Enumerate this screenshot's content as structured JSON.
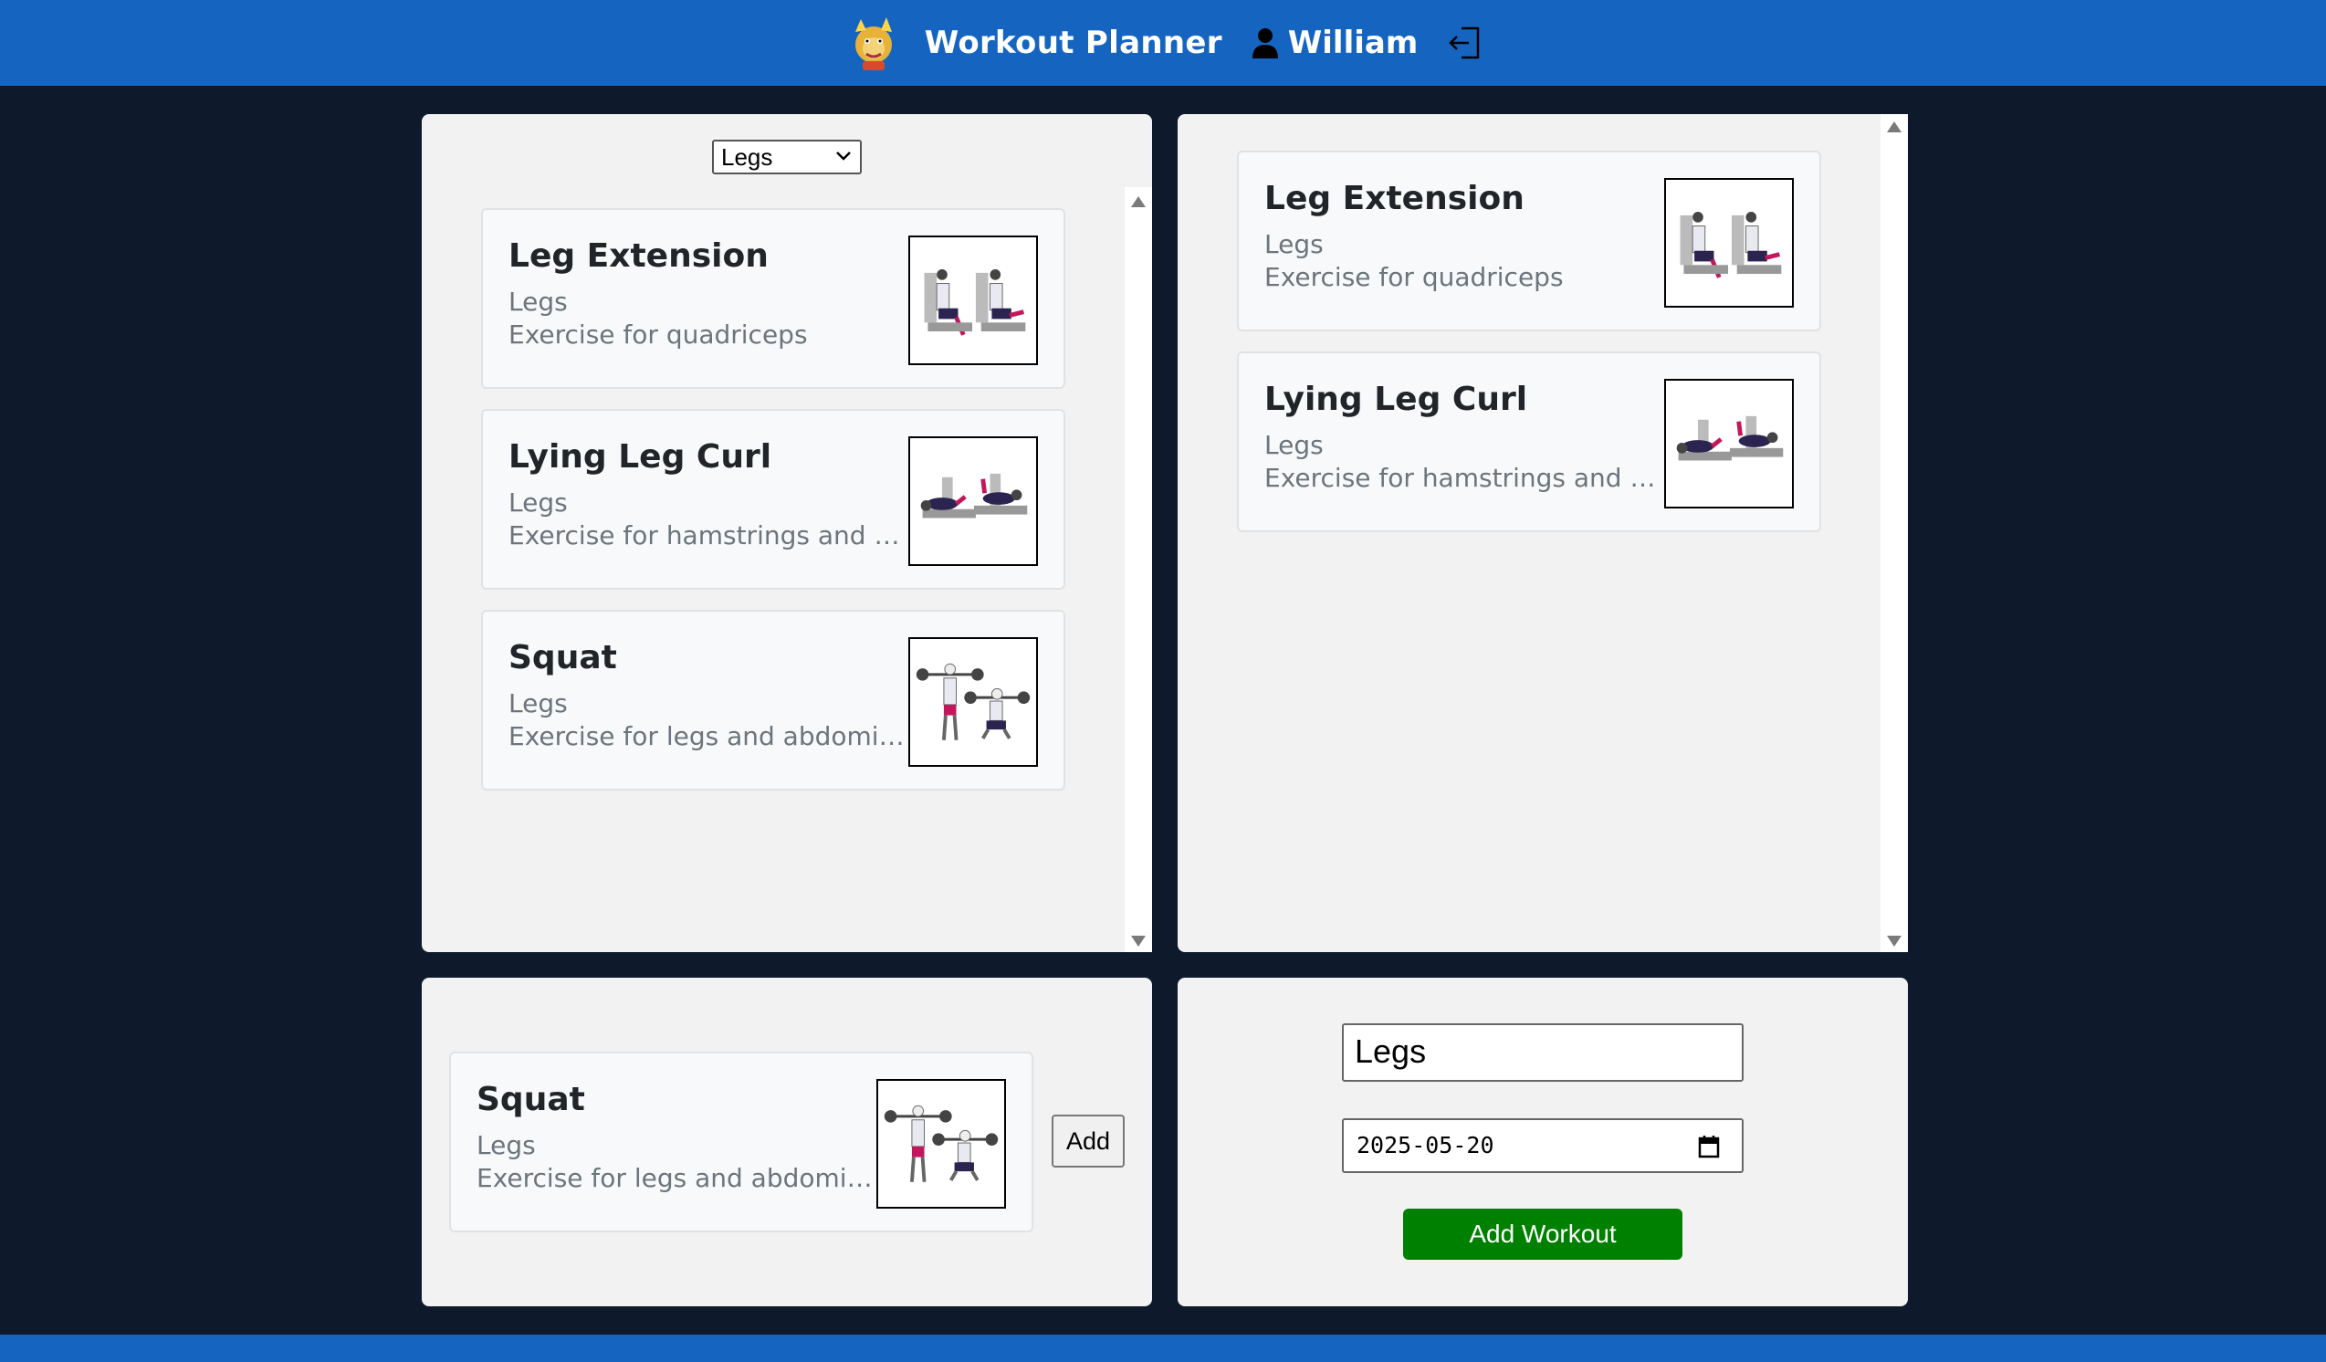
{
  "header": {
    "title": "Workout Planner",
    "username": "William"
  },
  "exercise_list": {
    "category_filter": "Legs",
    "exercises": [
      {
        "name": "Leg Extension",
        "category": "Legs",
        "description": "Exercise for quadriceps"
      },
      {
        "name": "Lying Leg Curl",
        "category": "Legs",
        "description": "Exercise for hamstrings and c..."
      },
      {
        "name": "Squat",
        "category": "Legs",
        "description": "Exercise for legs and abdomin..."
      }
    ]
  },
  "workout_plan": {
    "exercises": [
      {
        "name": "Leg Extension",
        "category": "Legs",
        "description": "Exercise for quadriceps"
      },
      {
        "name": "Lying Leg Curl",
        "category": "Legs",
        "description": "Exercise for hamstrings and c..."
      }
    ]
  },
  "selected_exercise": {
    "name": "Squat",
    "category": "Legs",
    "description": "Exercise for legs and abdomin...",
    "add_label": "Add"
  },
  "workout_form": {
    "name_value": "Legs",
    "date_value": "2025-05-20",
    "submit_label": "Add Workout"
  },
  "colors": {
    "header_bg": "#1565c0",
    "page_bg": "#0e1a2b",
    "panel_bg": "#f2f2f2",
    "submit_bg": "#008000"
  },
  "icons": [
    "logo-icon",
    "user-icon",
    "logout-icon",
    "chevron-down-icon",
    "calendar-icon",
    "scroll-up-icon",
    "scroll-down-icon"
  ]
}
